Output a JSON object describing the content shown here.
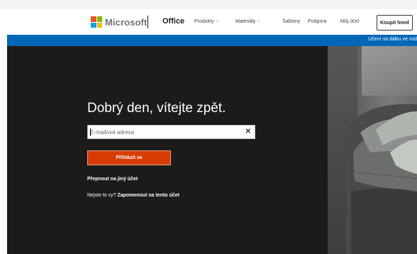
{
  "header": {
    "logo_text": "Microsoft",
    "product": "Office",
    "nav": [
      {
        "label": "Produkty",
        "dropdown": true
      },
      {
        "label": "Materiály",
        "dropdown": true
      },
      {
        "label": "Šablony",
        "dropdown": false
      },
      {
        "label": "Podpora",
        "dropdown": false
      },
      {
        "label": "Můj účet",
        "dropdown": false
      }
    ],
    "buy_label": "Koupit hned",
    "chevron_glyph": "⌵"
  },
  "banner": {
    "text": "Učení na dálku ve vzd"
  },
  "hero": {
    "title": "Dobrý den, vítejte zpět.",
    "email_placeholder": "E-mailová adresa",
    "clear_glyph": "✕",
    "signin_label": "Přihlásit se",
    "switch_account": "Přepnout na jiný účet",
    "not_you": "Nejste to vy?",
    "forget_account": "Zapomenout na tento účet"
  },
  "colors": {
    "banner_blue": "#0067b8",
    "signin_orange": "#d83b01",
    "hero_dark": "#1c1b1a"
  }
}
